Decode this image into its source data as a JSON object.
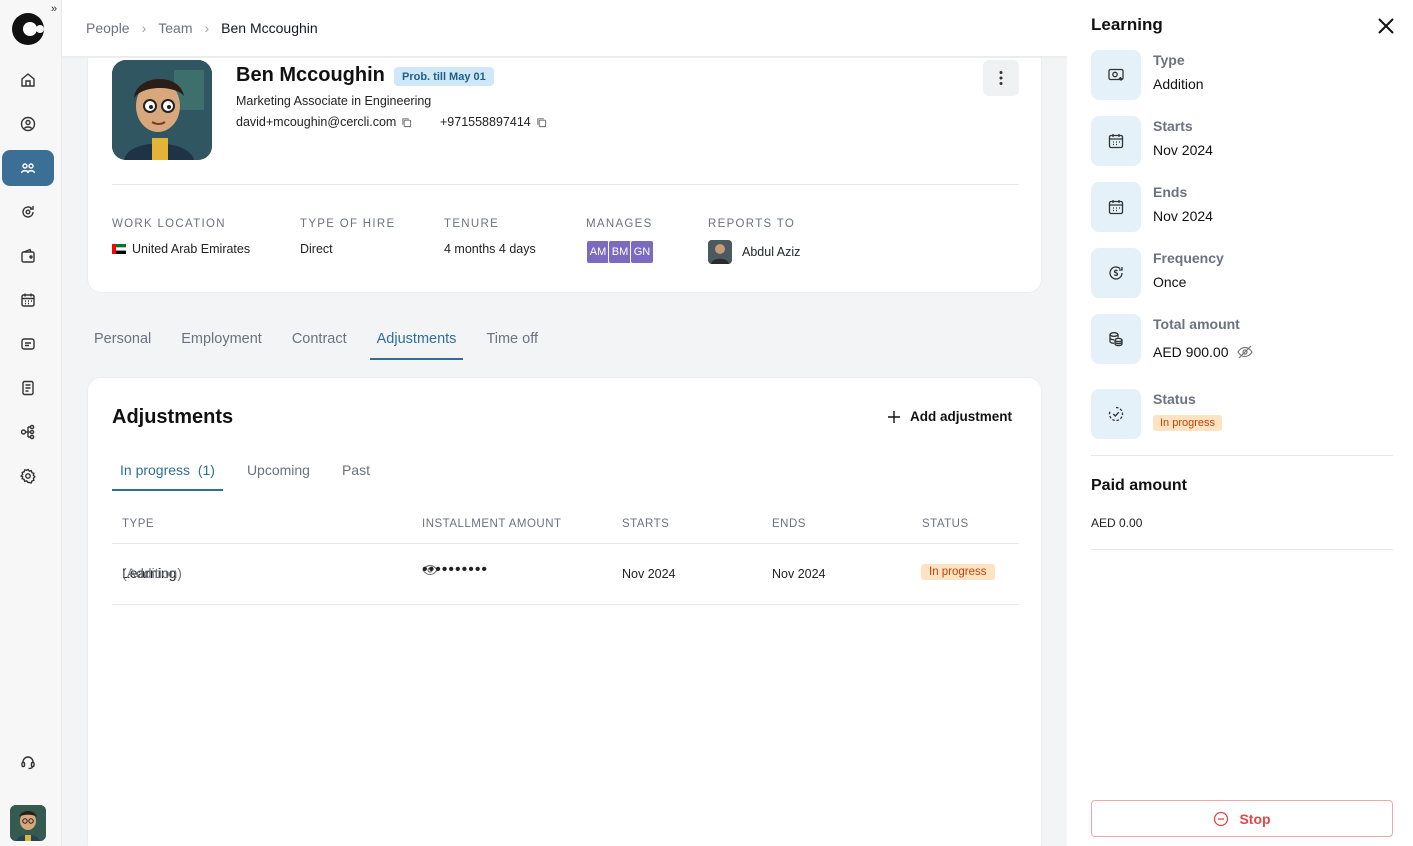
{
  "breadcrumb": [
    "People",
    "Team",
    "Ben Mccoughin"
  ],
  "profile": {
    "name": "Ben Mccoughin",
    "probation_badge": "Prob. till May 01",
    "role": "Marketing Associate in Engineering",
    "email": "david+mcoughin@cercli.com",
    "phone": "+971558897414",
    "work_location_label": "WORK LOCATION",
    "work_location": "United Arab Emirates",
    "type_of_hire_label": "TYPE OF HIRE",
    "type_of_hire": "Direct",
    "tenure_label": "TENURE",
    "tenure": "4 months 4 days",
    "manages_label": "MANAGES",
    "manages": [
      "AM",
      "BM",
      "GN"
    ],
    "reports_to_label": "REPORTS TO",
    "reports_to": "Abdul Aziz"
  },
  "tabs": [
    "Personal",
    "Employment",
    "Contract",
    "Adjustments",
    "Time off"
  ],
  "active_tab": "Adjustments",
  "adjustments": {
    "title": "Adjustments",
    "add_label": "Add adjustment",
    "subtabs": [
      "In progress  (1)",
      "Upcoming",
      "Past"
    ],
    "columns": [
      "TYPE",
      "INSTALLMENT AMOUNT",
      "STARTS",
      "ENDS",
      "STATUS"
    ],
    "rows": [
      {
        "type": "Learning",
        "kind": "(Addition)",
        "amount": "••••••••••",
        "starts": "Nov 2024",
        "ends": "Nov 2024",
        "status": "In progress"
      }
    ]
  },
  "panel": {
    "title": "Learning",
    "type_label": "Type",
    "type": "Addition",
    "starts_label": "Starts",
    "starts": "Nov 2024",
    "ends_label": "Ends",
    "ends": "Nov 2024",
    "frequency_label": "Frequency",
    "frequency": "Once",
    "total_label": "Total amount",
    "total": "AED 900.00",
    "status_label": "Status",
    "status": "In progress",
    "paid_title": "Paid amount",
    "paid": "AED 0.00",
    "stop_label": "Stop"
  },
  "colors": {
    "accent": "#2f6f96",
    "nav_active": "#3b6f95",
    "status_bg": "#fde3c1",
    "status_fg": "#c2410c",
    "stop": "#e04848"
  }
}
